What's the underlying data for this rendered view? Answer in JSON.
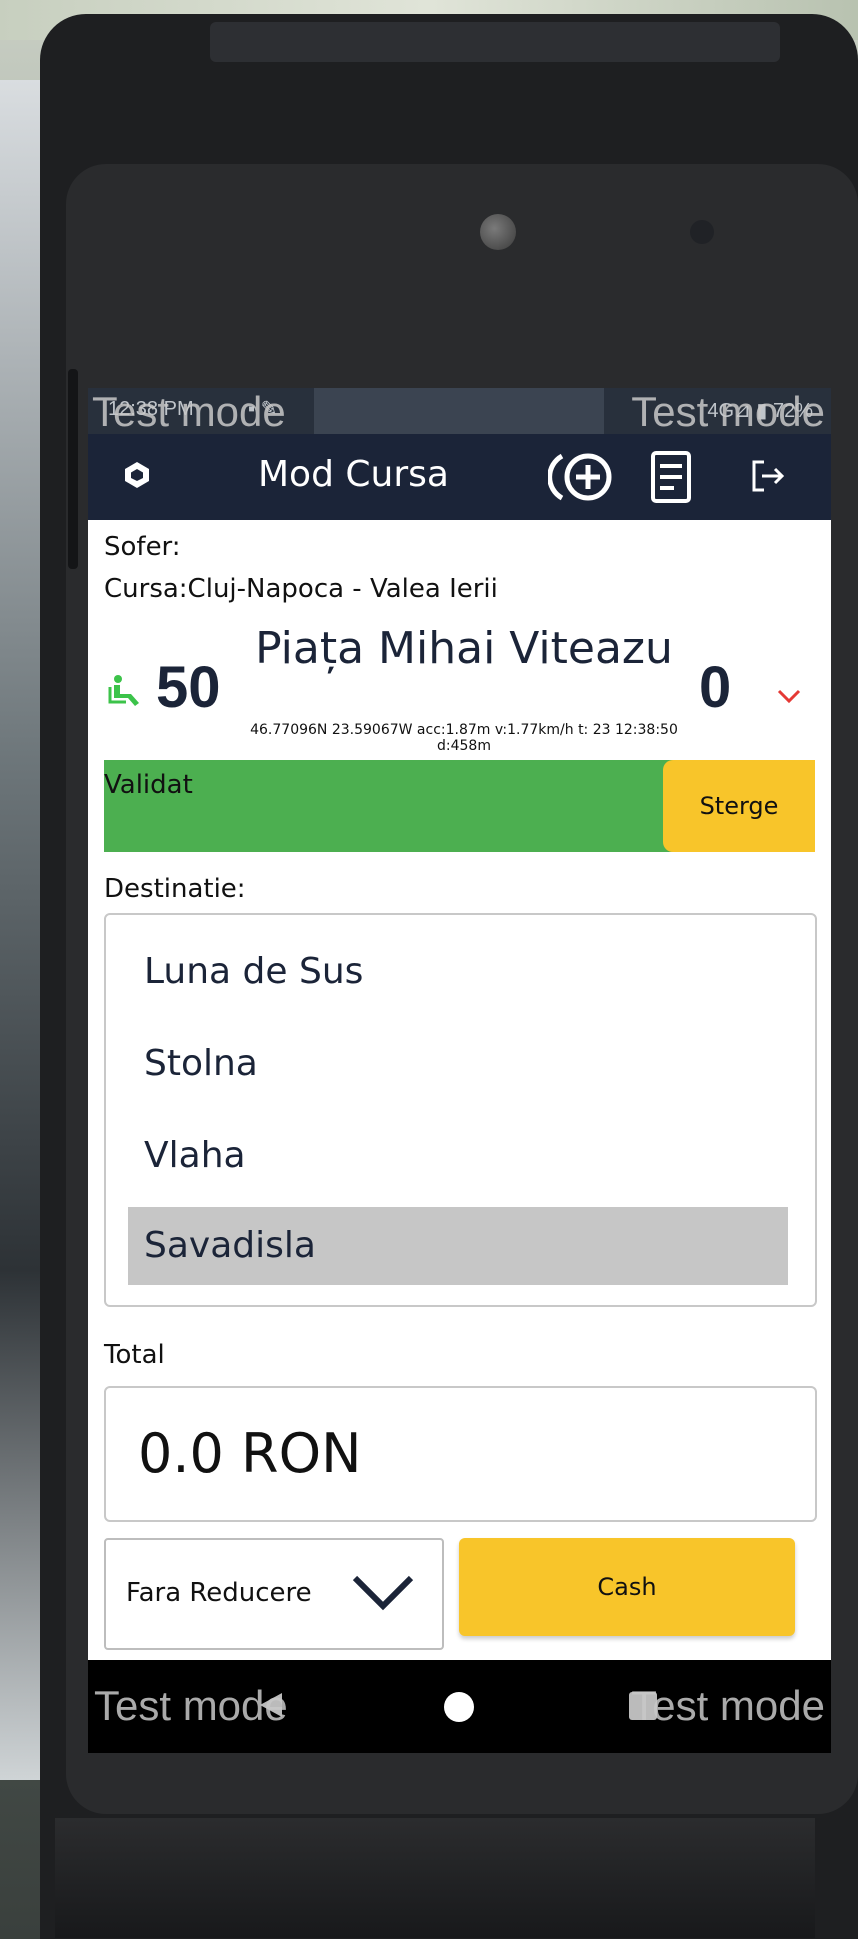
{
  "status_bar": {
    "time": "12:38 PM",
    "icons": "▪ ✎",
    "right": "4G⊿ ▮ 72%",
    "watermark_left": "Test mode",
    "watermark_right": "Test mode"
  },
  "app_bar": {
    "title": "Mod Cursa",
    "logo_icon": "app-logo-icon",
    "add_icon": "add-passenger-icon",
    "doc_icon": "receipt-icon",
    "exit_icon": "logout-icon"
  },
  "trip": {
    "driver_label": "Sofer:",
    "route_label": "Cursa:Cluj-Napoca - Valea Ierii",
    "seats_available": "50",
    "station": "Piața  Mihai Viteazu",
    "gps": "46.77096N 23.59067W acc:1.87m v:1.77km/h t: 23 12:38:50 d:458m",
    "count": "0"
  },
  "validation": {
    "status": "Validat",
    "delete_label": "Sterge"
  },
  "destination": {
    "label": "Destinatie:",
    "items": [
      "Luna de Sus",
      "Stolna",
      "Vlaha",
      "Savadisla"
    ],
    "selected": "Savadisla"
  },
  "total": {
    "label": "Total",
    "value": "0.0 RON"
  },
  "discount": {
    "selected": "Fara Reducere"
  },
  "payment": {
    "cash_label": "Cash"
  },
  "nav_bar": {
    "watermark_left": "Test mode",
    "watermark_right": "Test mode"
  },
  "colors": {
    "app_bar": "#1b2438",
    "valid": "#4caf50",
    "accent_yellow": "#f8c52a",
    "seat_icon": "#3cc34a",
    "chevron_red": "#e53935"
  }
}
